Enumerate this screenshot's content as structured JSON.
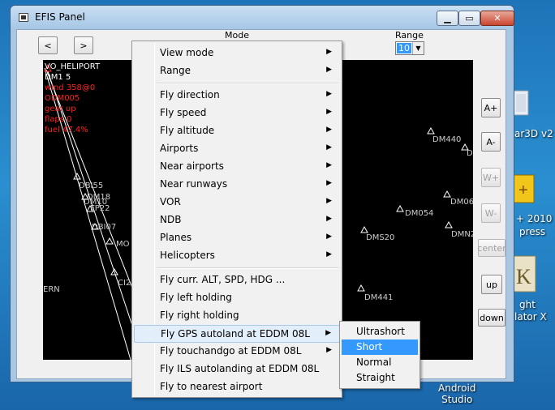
{
  "window": {
    "title": "EFIS Panel",
    "controls": {
      "minimize": "▁",
      "maximize": "▭",
      "close": "✕"
    }
  },
  "toolbar": {
    "prev": "<",
    "next": ">",
    "mode_label": "Mode",
    "range_label": "Range",
    "range_value": "10"
  },
  "side_buttons": {
    "a_plus": "A+",
    "a_minus": "A-",
    "w_plus": "W+",
    "w_minus": "W-",
    "center": "center",
    "up": "up",
    "down": "down"
  },
  "map": {
    "left_texts": {
      "line1": "VO_HELIPORT",
      "line2": "DM1 5",
      "line3": "wind 358@0",
      "line4": "ODM005",
      "line5": "gear up",
      "line6": "flaps 0",
      "line7": "fuel 47.4%"
    },
    "waypoints": {
      "dbs5": "DBI55",
      "dm18": "DM18",
      "dm10": "DM10",
      "fp2": "FP22",
      "db07": "DBI07",
      "mo": "MO",
      "ci2": "CI2",
      "ern": "ERN",
      "dm440": "DM440",
      "d": "D",
      "dm054": "DM054",
      "dm06": "DM06",
      "dms20": "DMS20",
      "dmn": "DMN2",
      "dm441": "DM441"
    },
    "colors": {
      "background": "#000000",
      "text": "#ffffff",
      "info": "#ff2020"
    }
  },
  "context_menu": {
    "items": [
      {
        "label": "View mode",
        "submenu": true
      },
      {
        "label": "Range",
        "submenu": true
      },
      {
        "label": "Fly direction",
        "submenu": true
      },
      {
        "label": "Fly speed",
        "submenu": true
      },
      {
        "label": "Fly altitude",
        "submenu": true
      },
      {
        "label": "Airports",
        "submenu": true
      },
      {
        "label": "Near airports",
        "submenu": true
      },
      {
        "label": "Near runways",
        "submenu": true
      },
      {
        "label": "VOR",
        "submenu": true
      },
      {
        "label": "NDB",
        "submenu": true
      },
      {
        "label": "Planes",
        "submenu": true
      },
      {
        "label": "Helicopters",
        "submenu": true
      },
      {
        "label": "Fly curr. ALT, SPD, HDG ...",
        "submenu": false
      },
      {
        "label": "Fly left holding",
        "submenu": false
      },
      {
        "label": "Fly right holding",
        "submenu": false
      },
      {
        "label": "Fly GPS autoland at EDDM 08L",
        "submenu": true
      },
      {
        "label": "Fly touchandgo at EDDM 08L",
        "submenu": true
      },
      {
        "label": "Fly ILS autolanding at EDDM 08L",
        "submenu": false
      },
      {
        "label": "Fly to nearest airport",
        "submenu": false
      }
    ],
    "submenu_arrow": "▶"
  },
  "autoland_submenu": {
    "items": [
      "Ultrashort",
      "Short",
      "Normal",
      "Straight"
    ],
    "selected": "Short"
  },
  "desktop": {
    "icon1_label": "Android\nStudio",
    "icon2_label_a": "ar3D v2",
    "icon3_label_a": "+ 2010",
    "icon3_label_b": "press",
    "icon4_label_a": "ght",
    "icon4_label_b": "lator X"
  }
}
